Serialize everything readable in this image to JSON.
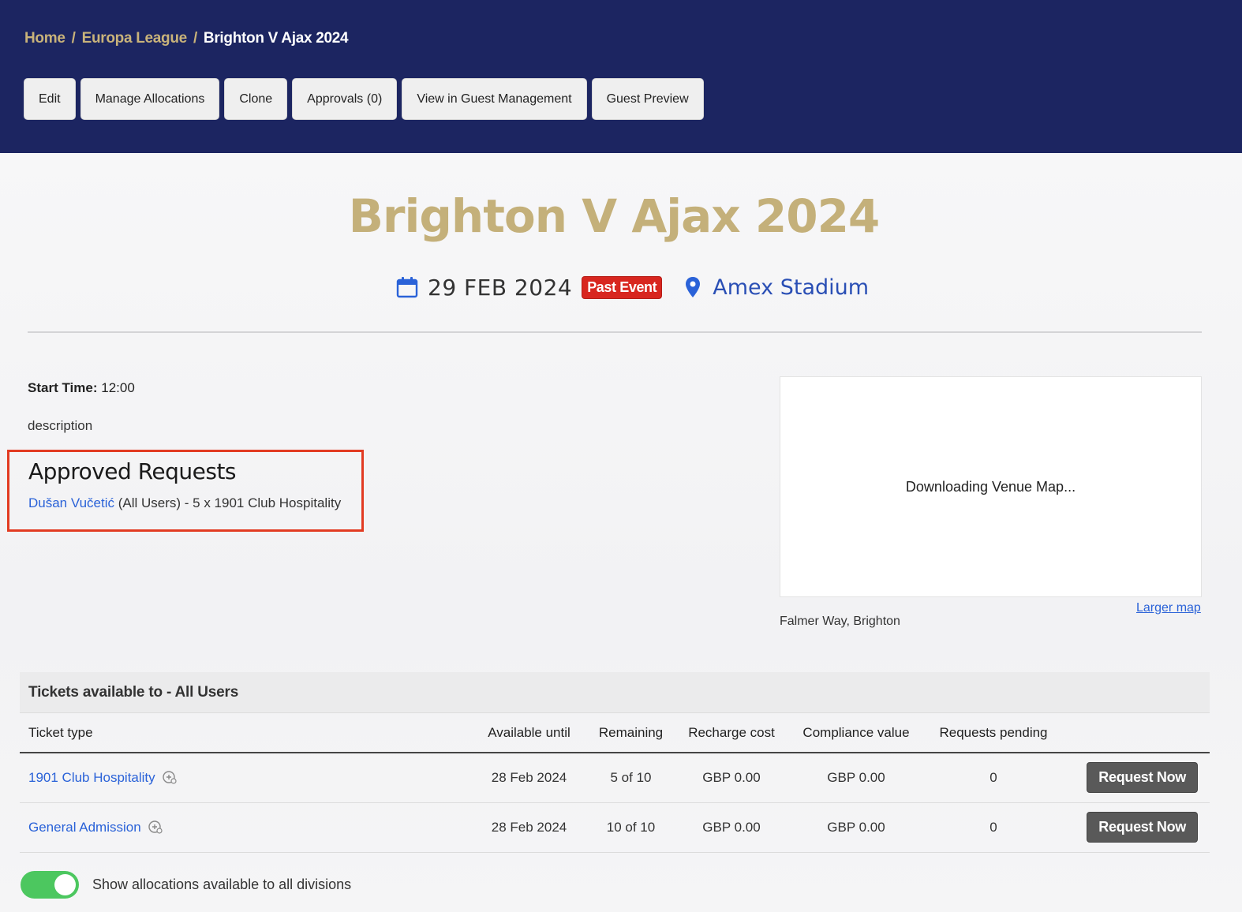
{
  "breadcrumb": {
    "home": "Home",
    "sep": "/",
    "section": "Europa League",
    "current": "Brighton V Ajax 2024"
  },
  "toolbar": {
    "edit": "Edit",
    "manage_allocations": "Manage Allocations",
    "clone": "Clone",
    "approvals": "Approvals (0)",
    "view_guest_management": "View in Guest Management",
    "guest_preview": "Guest Preview"
  },
  "event": {
    "title": "Brighton V Ajax 2024",
    "date": "29 FEB 2024",
    "status_badge": "Past Event",
    "venue": "Amex Stadium",
    "start_time_label": "Start Time:",
    "start_time_value": "12:00",
    "description": "description"
  },
  "approved_requests": {
    "heading": "Approved Requests",
    "user": "Dušan Vučetić",
    "detail": " (All Users) - 5 x 1901 Club Hospitality"
  },
  "map": {
    "loading_text": "Downloading Venue Map...",
    "larger_map": "Larger map",
    "address": "Falmer Way, Brighton"
  },
  "tickets": {
    "panel_title": "Tickets available to - All Users",
    "columns": [
      "Ticket type",
      "Available until",
      "Remaining",
      "Recharge cost",
      "Compliance value",
      "Requests pending"
    ],
    "rows": [
      {
        "name": "1901 Club Hospitality",
        "available_until": "28 Feb 2024",
        "remaining": "5 of 10",
        "recharge_cost": "GBP 0.00",
        "compliance_value": "GBP 0.00",
        "requests_pending": "0",
        "action": "Request Now"
      },
      {
        "name": "General Admission",
        "available_until": "28 Feb 2024",
        "remaining": "10 of 10",
        "recharge_cost": "GBP 0.00",
        "compliance_value": "GBP 0.00",
        "requests_pending": "0",
        "action": "Request Now"
      }
    ]
  },
  "toggle": {
    "label": "Show allocations available to all divisions",
    "on": true
  },
  "colors": {
    "header_bg": "#1c2561",
    "gold": "#c4b07a",
    "link": "#2a62d8",
    "badge_red": "#d8261f",
    "toggle_green": "#4cc75f",
    "highlight_border": "#e23b22"
  },
  "icons": {
    "date": "calendar-icon",
    "venue": "map-pin-icon",
    "ticket_info": "info-icon"
  }
}
